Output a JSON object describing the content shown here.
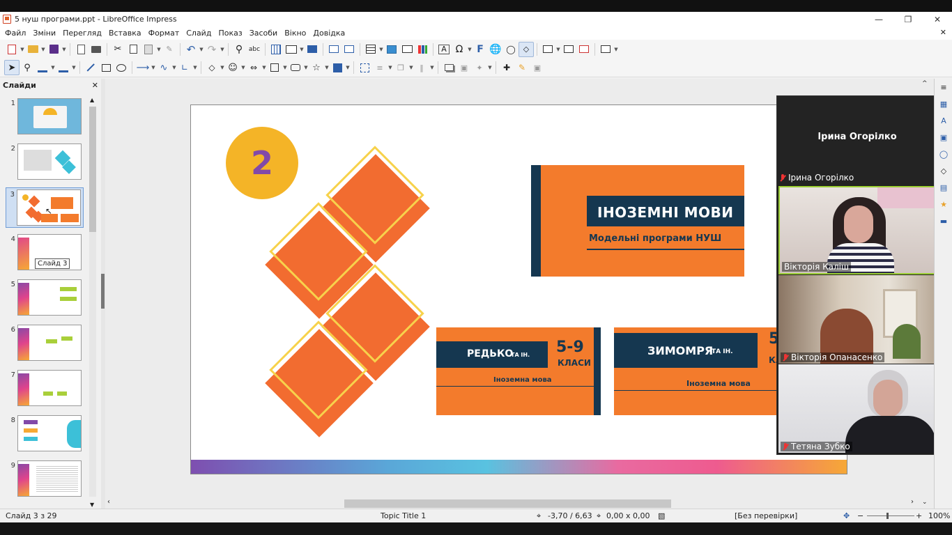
{
  "window": {
    "title": "5 нуш програми.ppt - LibreOffice Impress"
  },
  "menu": [
    "Файл",
    "Зміни",
    "Перегляд",
    "Вставка",
    "Формат",
    "Слайд",
    "Показ",
    "Засоби",
    "Вікно",
    "Довідка"
  ],
  "sidebar": {
    "title": "Слайди",
    "tooltip": "Слайд 3",
    "slides": [
      "1",
      "2",
      "3",
      "4",
      "5",
      "6",
      "7",
      "8",
      "9"
    ],
    "selected": 3
  },
  "slide": {
    "number_badge": "2",
    "banner_main": {
      "title": "ІНОЗЕМНІ МОВИ",
      "subtitle": "Модельні програми НУШ"
    },
    "banner_left": {
      "title": "РЕДЬКО",
      "title_suffix": "ТА ІН.",
      "grades": "5-9",
      "grades_label": "КЛАСИ",
      "subtitle": "Іноземна мова"
    },
    "banner_right": {
      "title": "ЗИМОМРЯ",
      "title_suffix": "ТА ІН.",
      "grades": "5",
      "grades_label": "КЛ",
      "subtitle": "Іноземна мова"
    },
    "colors": {
      "orange": "#f26c30",
      "navy": "#153750",
      "yellow": "#f4b427",
      "purple": "#8249a8"
    }
  },
  "meeting": {
    "host": "Ірина Огорілко",
    "host_label": "Ірина Огорілко",
    "participants": [
      {
        "name": "Вікторія Каліш",
        "muted": false
      },
      {
        "name": "Вікторія Опанасенко",
        "muted": true
      },
      {
        "name": "Тетяна Зубко",
        "muted": true
      }
    ]
  },
  "status": {
    "slide": "Слайд 3 з 29",
    "layout": "Topic Title 1",
    "position": "-3,70 / 6,63",
    "size": "0,00 x 0,00",
    "language": "[Без перевірки]",
    "zoom": "100%"
  }
}
